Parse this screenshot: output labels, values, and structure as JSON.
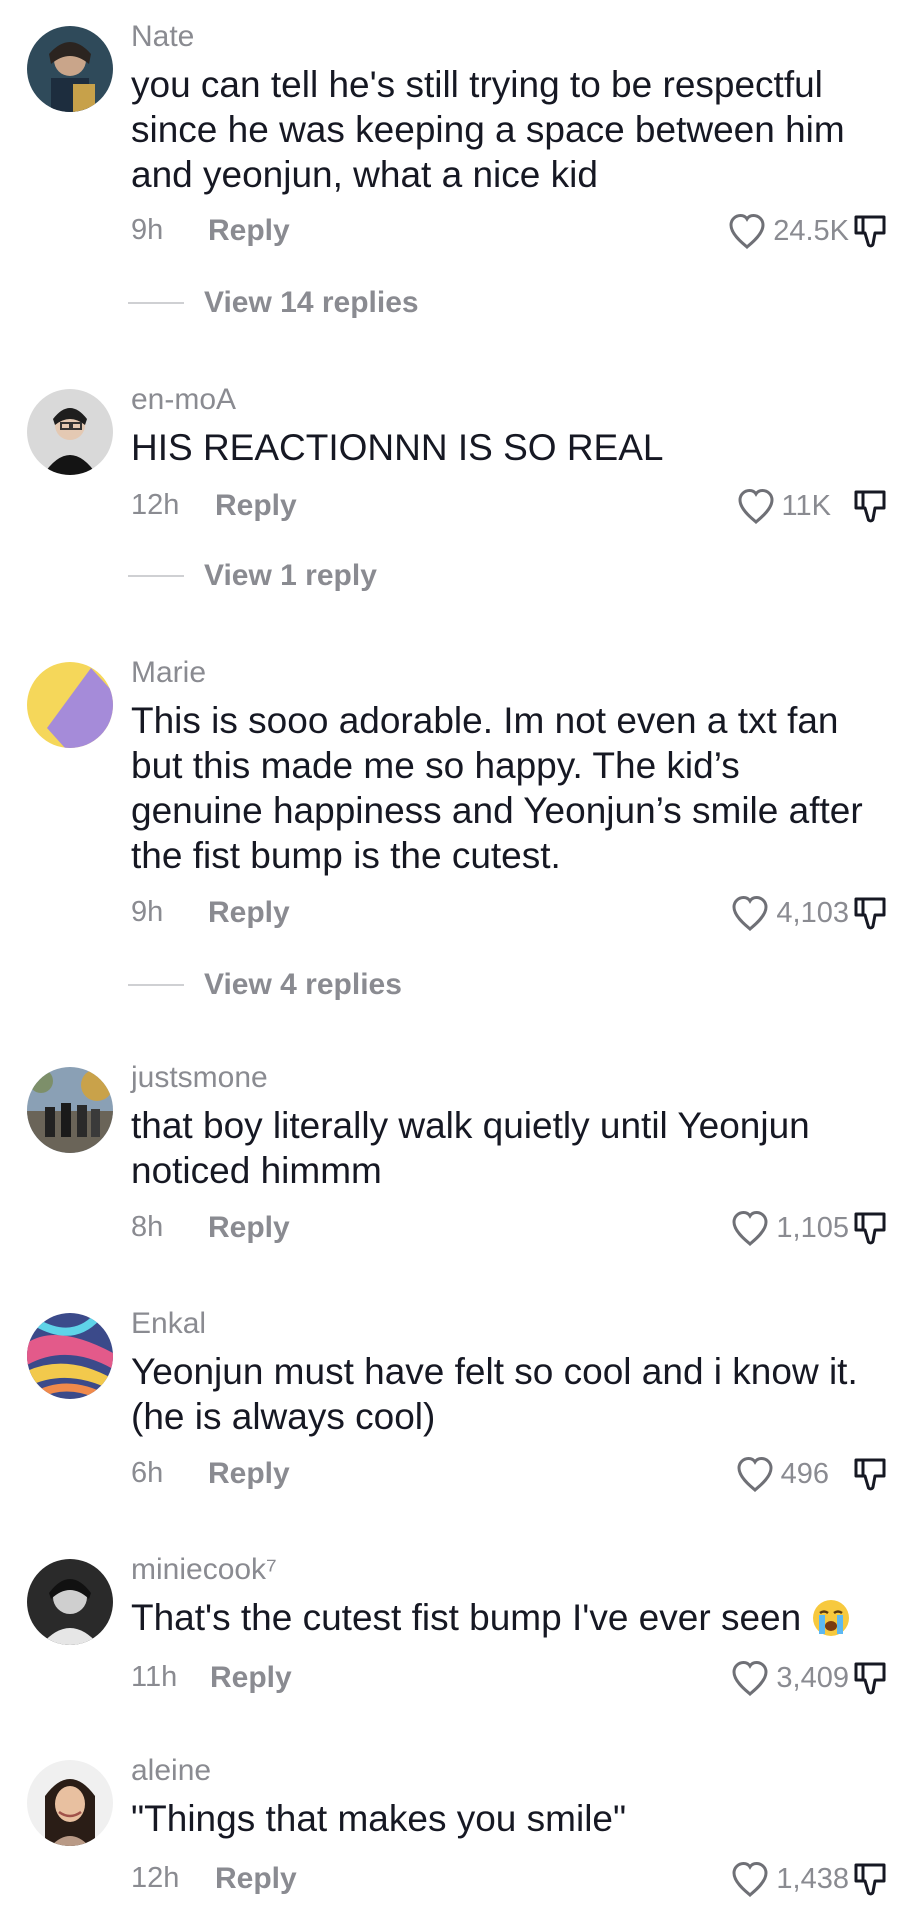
{
  "comments": [
    {
      "username": "Nate",
      "text": "you can tell he's still trying to be respectful since he was keeping a space between him and yeonjun, what a nice kid",
      "time": "9h",
      "reply_label": "Reply",
      "likes": "24.5K",
      "view_replies": "View 14 replies"
    },
    {
      "username": "en-moA",
      "text": "HIS REACTIONNN IS SO REAL",
      "time": "12h",
      "reply_label": "Reply",
      "likes": "11K",
      "view_replies": "View 1 reply"
    },
    {
      "username": "Marie",
      "text": "This is sooo adorable. Im not even a txt fan but this made me so happy. The kid’s genuine happiness and Yeonjun’s smile after the fist bump is the cutest.",
      "time": "9h",
      "reply_label": "Reply",
      "likes": "4,103",
      "view_replies": "View 4 replies"
    },
    {
      "username": "justsmone",
      "text": "that boy literally walk quietly until Yeonjun noticed himmm",
      "time": "8h",
      "reply_label": "Reply",
      "likes": "1,105"
    },
    {
      "username": "Enkal",
      "text": "Yeonjun must have felt so cool and i know it. (he is always cool)",
      "time": "6h",
      "reply_label": "Reply",
      "likes": "496"
    },
    {
      "username": "miniecook⁷",
      "text": "That's the cutest fist bump I've ever seen",
      "time": "11h",
      "reply_label": "Reply",
      "likes": "3,409",
      "emoji_icon": "loudly-crying-face-emoji"
    },
    {
      "username": "aleine",
      "text": "\"Things that makes you smile\"",
      "time": "12h",
      "reply_label": "Reply",
      "likes": "1,438"
    }
  ],
  "icons": {
    "like": "heart-outline-icon",
    "dislike": "thumbs-down-outline-icon"
  },
  "colors": {
    "primary_text": "#161823",
    "secondary_text": "#8a8b91",
    "divider": "#cfd0d3",
    "background": "#ffffff"
  }
}
